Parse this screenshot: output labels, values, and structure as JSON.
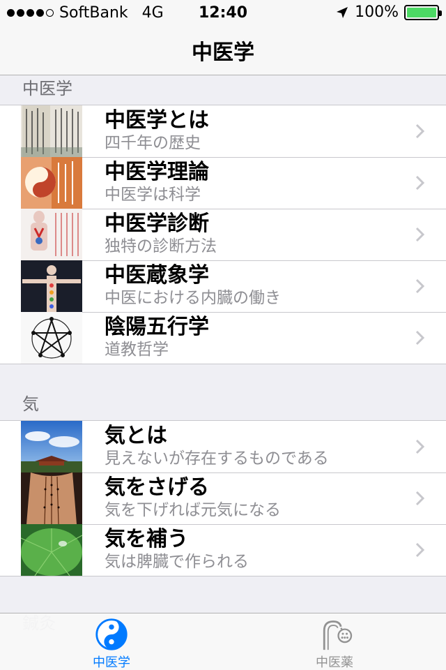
{
  "status_bar": {
    "carrier": "SoftBank",
    "network": "4G",
    "time": "12:40",
    "battery": "100%",
    "battery_level": 1.0
  },
  "nav": {
    "title": "中医学"
  },
  "sections": [
    {
      "header": "中医学",
      "items": [
        {
          "title": "中医学とは",
          "subtitle": "四千年の歴史",
          "thumb": "ancient-text-thumb"
        },
        {
          "title": "中医学理論",
          "subtitle": "中医学は科学",
          "thumb": "yin-yang-scroll-thumb"
        },
        {
          "title": "中医学診断",
          "subtitle": "独特の診断方法",
          "thumb": "anatomy-chart-thumb"
        },
        {
          "title": "中医蔵象学",
          "subtitle": "中医における内臓の働き",
          "thumb": "body-meridian-thumb"
        },
        {
          "title": "陰陽五行学",
          "subtitle": "道教哲学",
          "thumb": "five-elements-thumb"
        }
      ]
    },
    {
      "header": "気",
      "items": [
        {
          "title": "気とは",
          "subtitle": "見えないが存在するものである",
          "thumb": "sky-temple-thumb"
        },
        {
          "title": "気をさげる",
          "subtitle": "気を下げれば元気になる",
          "thumb": "acupuncture-back-thumb"
        },
        {
          "title": "気を補う",
          "subtitle": "気は脾臓で作られる",
          "thumb": "lotus-leaf-thumb"
        }
      ]
    },
    {
      "header": "鍼灸"
    }
  ],
  "tabs": [
    {
      "label": "中医学",
      "icon": "yin-yang-icon",
      "active": true
    },
    {
      "label": "中医薬",
      "icon": "herb-mortar-icon",
      "active": false
    }
  ],
  "colors": {
    "accent": "#007aff",
    "battery": "#4cd964"
  }
}
